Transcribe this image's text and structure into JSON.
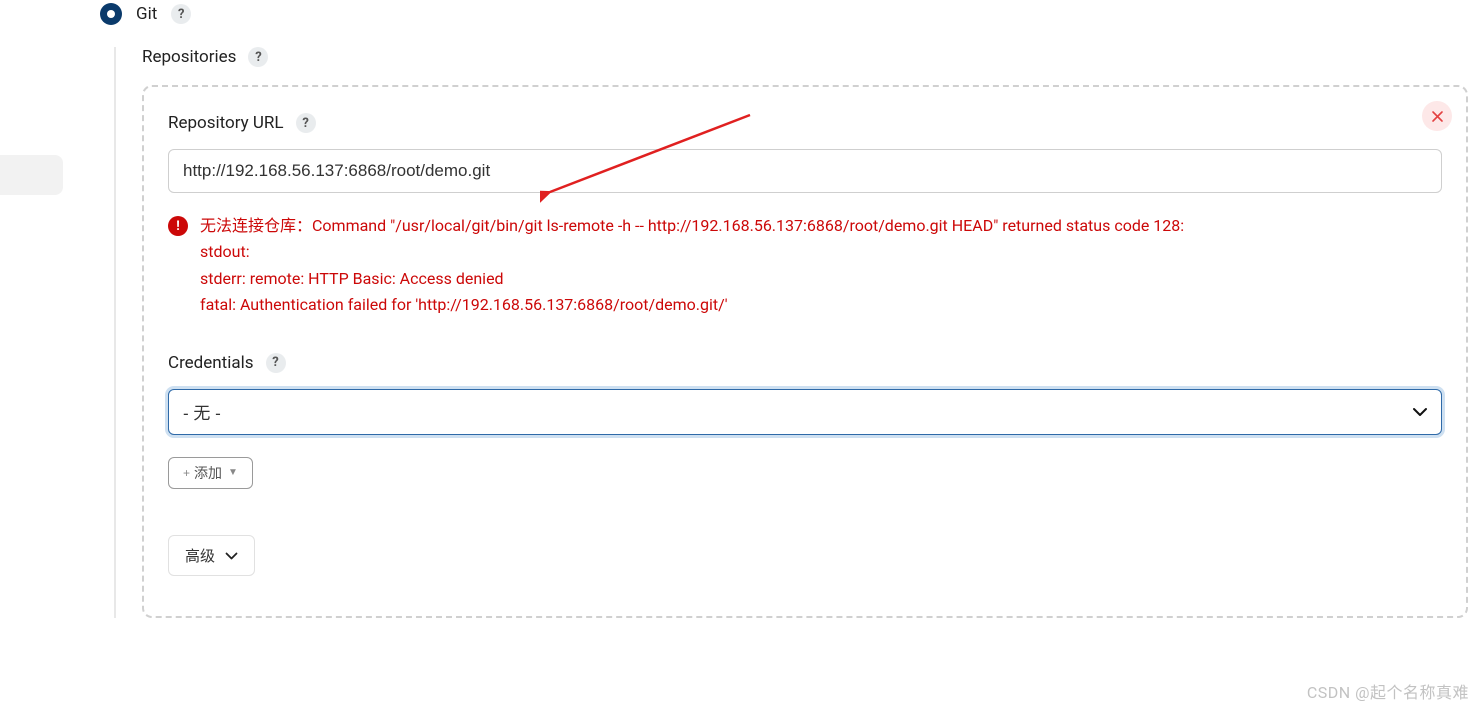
{
  "scm": {
    "git_label": "Git"
  },
  "repositories": {
    "heading": "Repositories",
    "url_label": "Repository URL",
    "url_value": "http://192.168.56.137:6868/root/demo.git",
    "error_line1": "无法连接仓库：Command \"/usr/local/git/bin/git ls-remote -h -- http://192.168.56.137:6868/root/demo.git HEAD\" returned status code 128:",
    "error_line2": "stdout:",
    "error_line3": "stderr: remote: HTTP Basic: Access denied",
    "error_line4": "fatal: Authentication failed for 'http://192.168.56.137:6868/root/demo.git/'",
    "credentials_label": "Credentials",
    "credentials_value": "- 无 -",
    "add_button": "添加",
    "advanced_button": "高级"
  },
  "watermark": "CSDN @起个名称真难"
}
